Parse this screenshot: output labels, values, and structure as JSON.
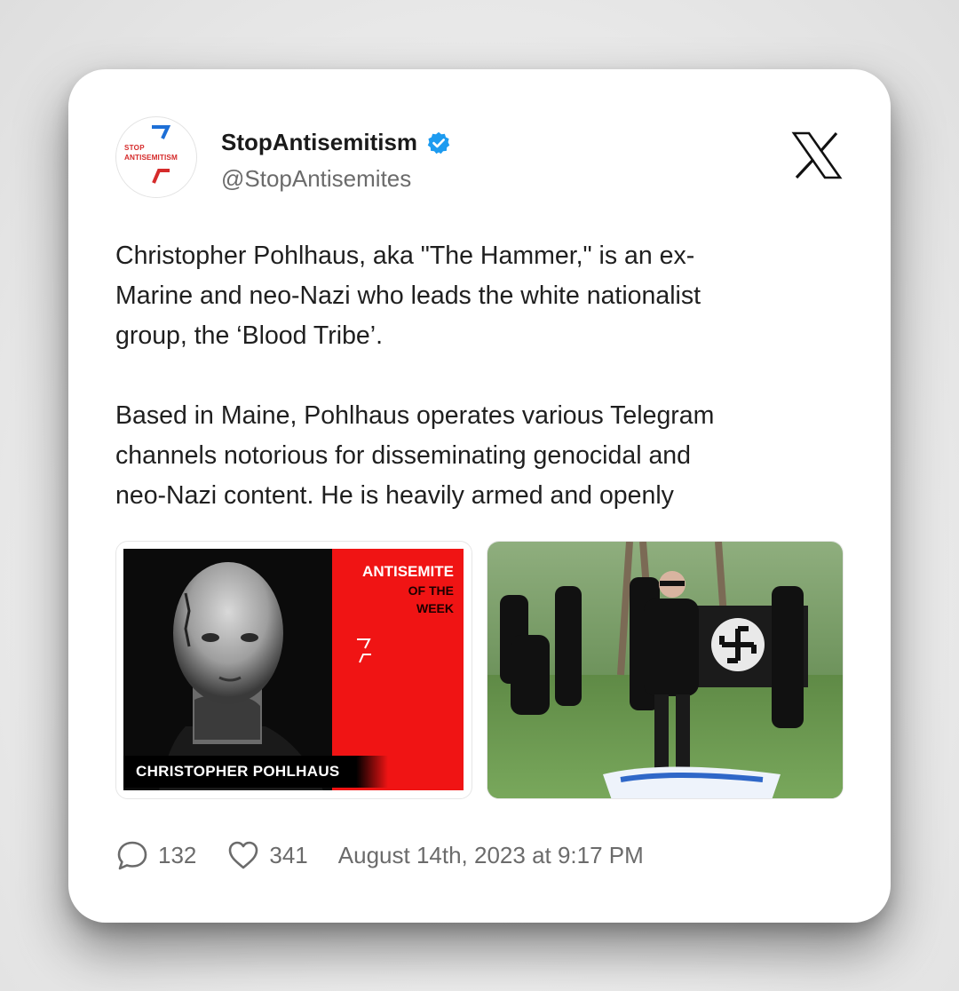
{
  "account": {
    "display_name": "StopAntisemitism",
    "handle": "@StopAntisemites",
    "avatar_text_top": "STOP",
    "avatar_text_bottom": "ANTISEMITISM",
    "verified": true
  },
  "tweet": {
    "text": "Christopher Pohlhaus, aka \"The Hammer,\" is an ex-\nMarine and neo-Nazi who leads the white nationalist\ngroup, the ‘Blood Tribe’.\n\nBased in Maine, Pohlhaus operates various Telegram\nchannels notorious for disseminating genocidal and\nneo-Nazi content. He is heavily armed and openly"
  },
  "media": {
    "left": {
      "title": "ANTISEMITE",
      "sub1": "OF THE",
      "sub2": "WEEK",
      "name": "CHRISTOPHER POHLHAUS"
    }
  },
  "footer": {
    "replies": "132",
    "likes": "341",
    "date": "August 14th, 2023 at 9:17 PM"
  },
  "colors": {
    "brand_red": "#d52b2b",
    "brand_blue": "#1d6fd6",
    "verified_blue": "#1d9bf0"
  },
  "icons": [
    "verified-badge-icon",
    "x-logo-icon",
    "reply-bubble-icon",
    "heart-icon"
  ]
}
